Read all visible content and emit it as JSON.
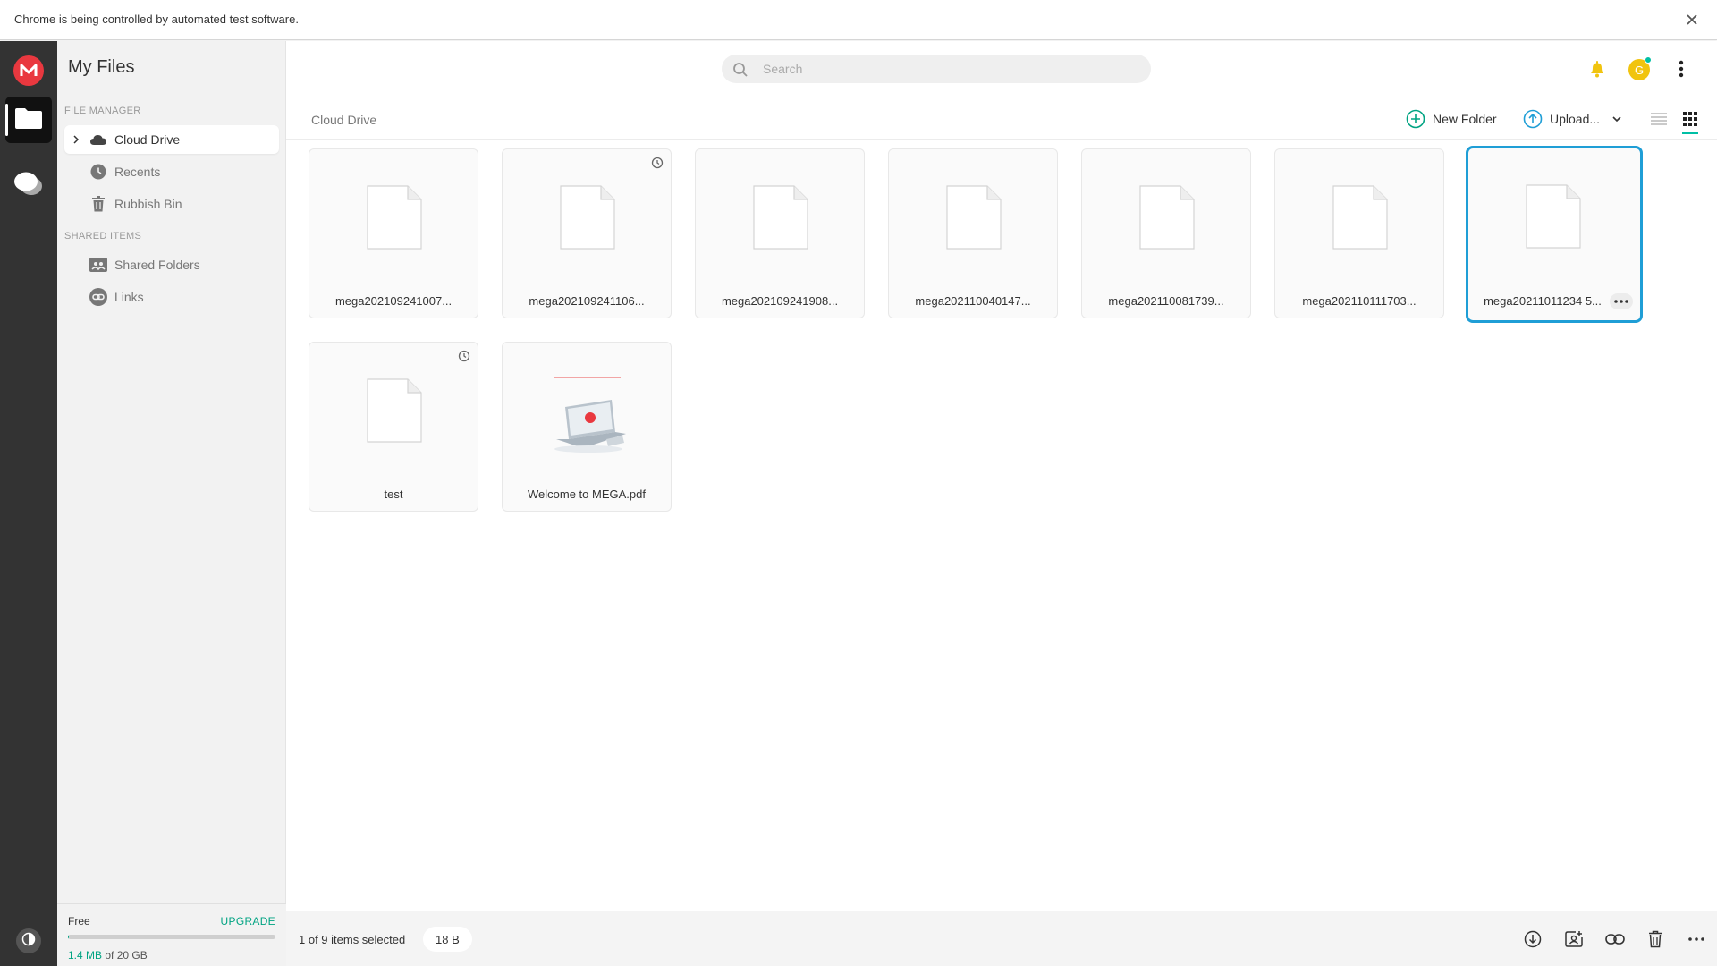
{
  "infobar": {
    "message": "Chrome is being controlled by automated test software.",
    "close_icon": "close-icon"
  },
  "rail": {
    "logo": "M",
    "items": [
      {
        "name": "file-manager",
        "icon": "folder-icon",
        "active": true
      },
      {
        "name": "chat",
        "icon": "chat-icon",
        "active": false
      }
    ]
  },
  "sidebar": {
    "title": "My Files",
    "section_file_manager": "FILE MANAGER",
    "section_shared": "SHARED ITEMS",
    "items": [
      {
        "label": "Cloud Drive",
        "icon": "cloud-icon",
        "active": true
      },
      {
        "label": "Recents",
        "icon": "clock-icon",
        "active": false
      },
      {
        "label": "Rubbish Bin",
        "icon": "trash-icon",
        "active": false
      },
      {
        "label": "Shared Folders",
        "icon": "shared-folder-icon",
        "active": false
      },
      {
        "label": "Links",
        "icon": "link-icon",
        "active": false
      }
    ],
    "storage": {
      "plan": "Free",
      "upgrade": "UPGRADE",
      "used": "1.4 MB",
      "of_total": "of 20 GB",
      "used_fraction": 7e-05
    }
  },
  "header": {
    "search_placeholder": "Search",
    "avatar_initial": "G"
  },
  "toolbar": {
    "breadcrumb": "Cloud Drive",
    "new_folder": "New Folder",
    "upload": "Upload..."
  },
  "files": [
    {
      "name": "mega202109241007...",
      "history": false,
      "selected": false
    },
    {
      "name": "mega202109241106...",
      "history": true,
      "selected": false
    },
    {
      "name": "mega202109241908...",
      "history": false,
      "selected": false
    },
    {
      "name": "mega202110040147...",
      "history": false,
      "selected": false
    },
    {
      "name": "mega202110081739...",
      "history": false,
      "selected": false
    },
    {
      "name": "mega202110111703...",
      "history": false,
      "selected": false
    },
    {
      "name": "mega20211011234 5...",
      "history": false,
      "selected": true
    },
    {
      "name": "test",
      "history": true,
      "selected": false
    },
    {
      "name": "Welcome to MEGA.pdf",
      "history": false,
      "selected": false
    }
  ],
  "selection": {
    "summary": "1 of 9 items selected",
    "size": "18 B"
  },
  "colors": {
    "accent": "#00a382",
    "selected_border": "#1f9ed6",
    "brand_red": "#e9383f",
    "rail_bg": "#333333"
  }
}
